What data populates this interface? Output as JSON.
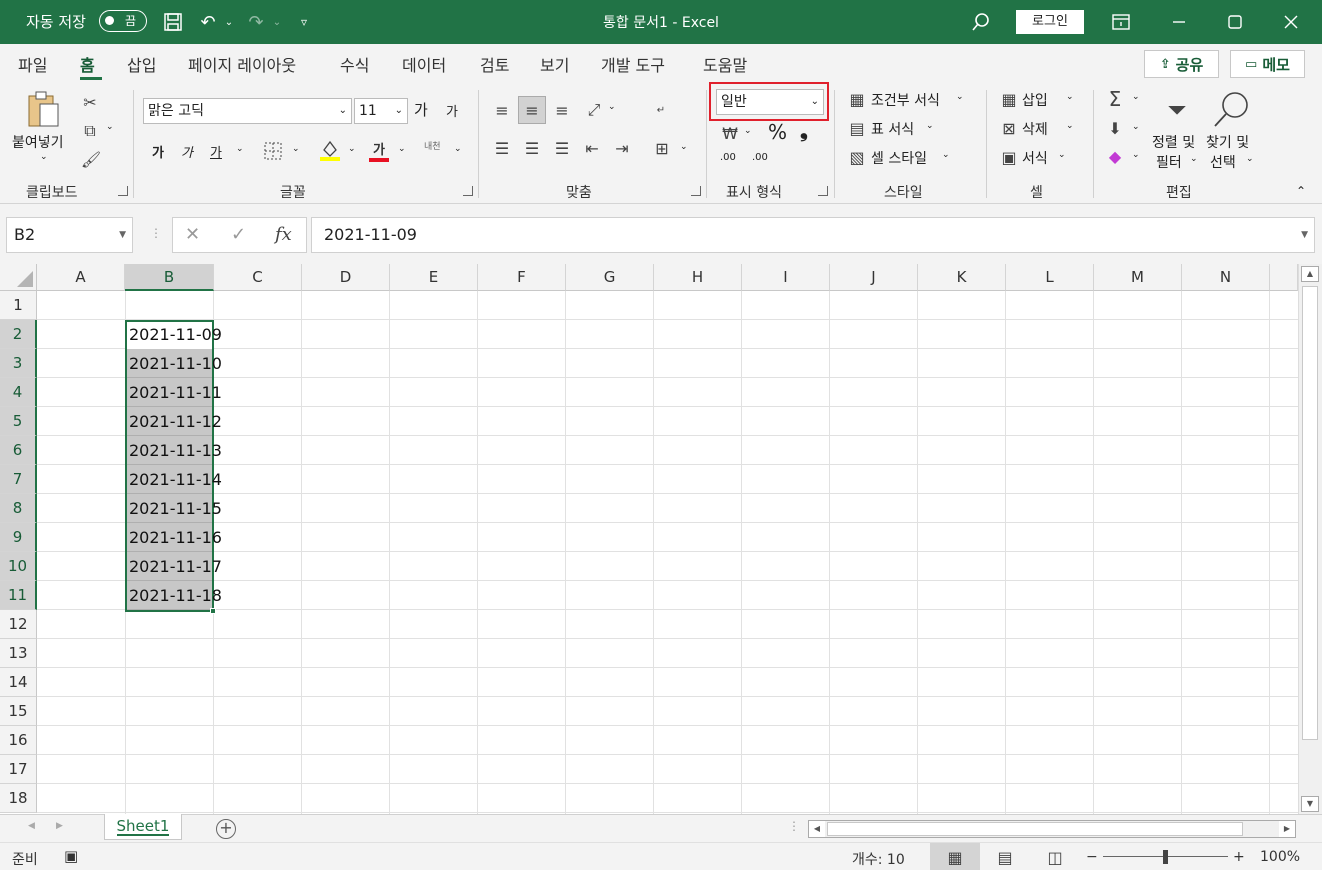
{
  "titlebar": {
    "autosave_label": "자동 저장",
    "autosave_state": "끔",
    "doc_title": "통합 문서1  -  Excel",
    "login_label": "로그인"
  },
  "ribbon_tabs": [
    "파일",
    "홈",
    "삽입",
    "페이지 레이아웃",
    "수식",
    "데이터",
    "검토",
    "보기",
    "개발 도구",
    "도움말"
  ],
  "active_tab": "홈",
  "share_label": "공유",
  "memo_label": "메모",
  "ribbon": {
    "clipboard": {
      "paste_label": "붙여넣기",
      "group_label": "클립보드"
    },
    "font": {
      "font_name": "맑은 고딕",
      "font_size": "11",
      "bold": "가",
      "italic": "가",
      "underline": "가",
      "font_color_glyph": "가",
      "group_label": "글꼴",
      "grow": "가",
      "shrink": "가",
      "phonetic": "내천"
    },
    "alignment": {
      "group_label": "맞춤"
    },
    "number": {
      "format_value": "일반",
      "group_label": "표시 형식",
      "percent": "%",
      "comma": "❟",
      "inc_decimal": ".00",
      "dec_decimal": ".00"
    },
    "styles": {
      "conditional": "조건부 서식",
      "table": "표 서식",
      "cell_style": "셀 스타일",
      "group_label": "스타일"
    },
    "cells": {
      "insert": "삽입",
      "delete": "삭제",
      "format": "서식",
      "group_label": "셀"
    },
    "editing": {
      "sort_line1": "정렬 및",
      "sort_line2": "필터",
      "find_line1": "찾기 및",
      "find_line2": "선택",
      "group_label": "편집"
    }
  },
  "formula_bar": {
    "name_box": "B2",
    "cancel": "✕",
    "enter": "✓",
    "fx": "fx",
    "formula": "2021-11-09"
  },
  "columns": [
    "A",
    "B",
    "C",
    "D",
    "E",
    "F",
    "G",
    "H",
    "I",
    "J",
    "K",
    "L",
    "M",
    "N"
  ],
  "rows": [
    "1",
    "2",
    "3",
    "4",
    "5",
    "6",
    "7",
    "8",
    "9",
    "10",
    "11",
    "12",
    "13",
    "14",
    "15",
    "16",
    "17",
    "18"
  ],
  "cells_b": [
    "2021-11-09",
    "2021-11-10",
    "2021-11-11",
    "2021-11-12",
    "2021-11-13",
    "2021-11-14",
    "2021-11-15",
    "2021-11-16",
    "2021-11-17",
    "2021-11-18"
  ],
  "sheet_tab": "Sheet1",
  "statusbar": {
    "ready": "준비",
    "count": "개수: 10",
    "zoom_minus": "−",
    "zoom_plus": "+",
    "zoom": "100%"
  },
  "colors": {
    "brand": "#217346",
    "selection_border": "#217346",
    "highlight": "#e0202c"
  }
}
